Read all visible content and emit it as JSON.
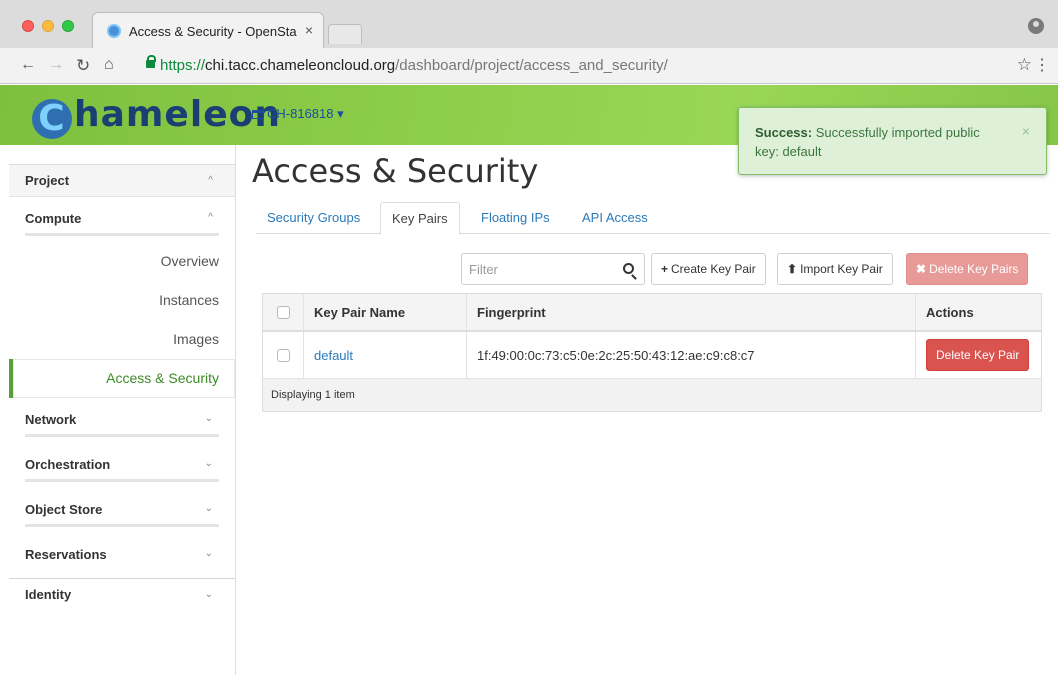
{
  "browser": {
    "tab_title": "Access & Security - OpenStac",
    "tab_close": "×",
    "url_scheme": "https://",
    "url_host": "chi.tacc.chameleoncloud.org",
    "url_path": "/dashboard/project/access_and_security/"
  },
  "header": {
    "brand_initial": "C",
    "brand_rest": "hameleon",
    "project": "CH-816818"
  },
  "alert": {
    "strong": "Success:",
    "message": "Successfully imported public key: default",
    "close": "×"
  },
  "sidebar": {
    "project": "Project",
    "compute": "Compute",
    "items": [
      "Overview",
      "Instances",
      "Images",
      "Access & Security"
    ],
    "groups": [
      "Network",
      "Orchestration",
      "Object Store",
      "Reservations"
    ],
    "identity": "Identity"
  },
  "page": {
    "title": "Access & Security",
    "tabs": [
      "Security Groups",
      "Key Pairs",
      "Floating IPs",
      "API Access"
    ],
    "active_tab": "Key Pairs"
  },
  "toolbar": {
    "filter_placeholder": "Filter",
    "create_label": "Create Key Pair",
    "import_label": "Import Key Pair",
    "delete_all_label": "Delete Key Pairs"
  },
  "table": {
    "headers": [
      "Key Pair Name",
      "Fingerprint",
      "Actions"
    ],
    "rows": [
      {
        "name": "default",
        "fingerprint": "1f:49:00:0c:73:c5:0e:2c:25:50:43:12:ae:c9:c8:c7",
        "action": "Delete Key Pair"
      }
    ],
    "footer": "Displaying 1 item"
  },
  "colors": {
    "header_green": "#8ccd49",
    "brand_blue": "#1b3f73",
    "link_blue": "#2a7ab8",
    "danger": "#d9534f",
    "success_bg": "#dff0d8"
  }
}
